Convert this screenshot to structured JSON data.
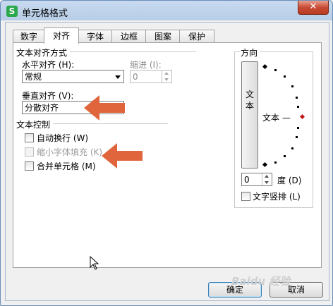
{
  "window": {
    "title": "单元格格式",
    "app_icon_glyph": "S",
    "app_icon": "wps-spreadsheet-icon",
    "close_glyph": "✕"
  },
  "tabs": [
    {
      "label": "数字"
    },
    {
      "label": "对齐"
    },
    {
      "label": "字体"
    },
    {
      "label": "边框"
    },
    {
      "label": "图案"
    },
    {
      "label": "保护"
    }
  ],
  "active_tab": "对齐",
  "text_alignment": {
    "group_label": "文本对齐方式",
    "horizontal": {
      "label": "水平对齐 (H):",
      "value": "常规"
    },
    "indent": {
      "label": "缩进 (I):",
      "value": "0"
    },
    "vertical": {
      "label": "垂直对齐 (V):",
      "value": "分散对齐"
    }
  },
  "text_control": {
    "group_label": "文本控制",
    "wrap_text": {
      "label": "自动换行 (W)",
      "checked": false
    },
    "shrink_to_fit": {
      "label": "缩小字体填充 (K)",
      "checked": false,
      "disabled": true
    },
    "merge_cells": {
      "label": "合并单元格 (M)",
      "checked": false
    }
  },
  "orientation": {
    "group_label": "方向",
    "vertical_text_button": "文本",
    "dial_text": "文本 —",
    "degree_value": "0",
    "degree_label": "度 (D)",
    "vertical_text_check": {
      "label": "文字竖排 (L)",
      "checked": false
    }
  },
  "buttons": {
    "ok": "确定",
    "cancel": "取消"
  },
  "annotations": {
    "arrow_color": "#e0643c"
  },
  "watermark": "Baidu 经验"
}
